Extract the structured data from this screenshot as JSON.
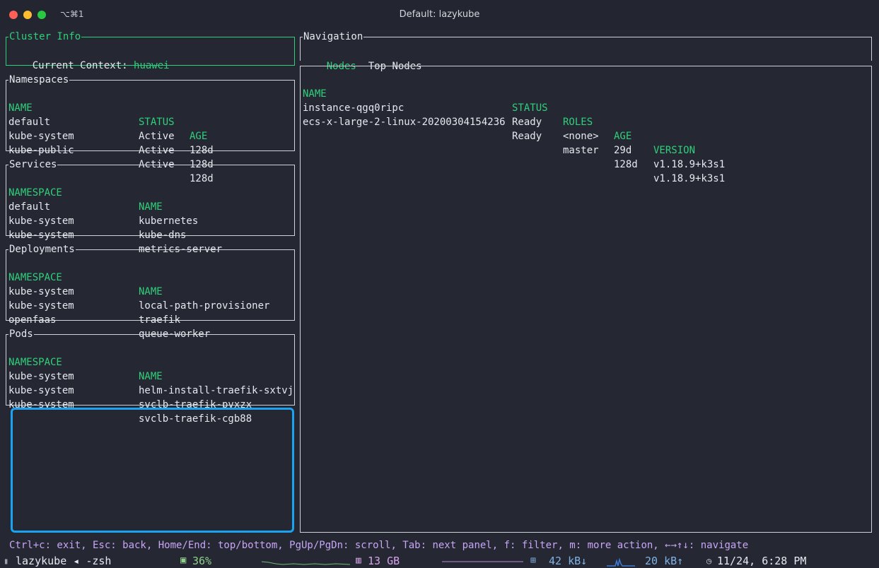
{
  "window": {
    "shortcut": "⌥⌘1",
    "title": "Default: lazykube"
  },
  "cluster_info": {
    "title": "Cluster Info",
    "context_label": "Current Context:",
    "context_value": "huawei"
  },
  "namespaces": {
    "title": "Namespaces",
    "headers": [
      "NAME",
      "STATUS",
      "AGE"
    ],
    "rows": [
      [
        "default",
        "Active",
        "128d"
      ],
      [
        "kube-system",
        "Active",
        "128d"
      ],
      [
        "kube-public",
        "Active",
        "128d"
      ]
    ]
  },
  "services": {
    "title": "Services",
    "headers": [
      "NAMESPACE",
      "NAME"
    ],
    "rows": [
      [
        "default",
        "kubernetes"
      ],
      [
        "kube-system",
        "kube-dns"
      ],
      [
        "kube-system",
        "metrics-server"
      ]
    ]
  },
  "deployments": {
    "title": "Deployments",
    "headers": [
      "NAMESPACE",
      "NAME"
    ],
    "rows": [
      [
        "kube-system",
        "local-path-provisioner"
      ],
      [
        "kube-system",
        "traefik"
      ],
      [
        "openfaas",
        "queue-worker"
      ]
    ]
  },
  "pods": {
    "title": "Pods",
    "headers": [
      "NAMESPACE",
      "NAME"
    ],
    "rows": [
      [
        "kube-system",
        "helm-install-traefik-sxtvj"
      ],
      [
        "kube-system",
        "svclb-traefik-pvxzx"
      ],
      [
        "kube-system",
        "svclb-traefik-cgb88"
      ]
    ]
  },
  "navigation": {
    "title": "Navigation",
    "tabs": [
      {
        "label": "Nodes",
        "selected": true
      },
      {
        "label": "Top Nodes",
        "selected": false
      }
    ]
  },
  "nodes": {
    "headers": [
      "NAME",
      "STATUS",
      "ROLES",
      "AGE",
      "VERSION"
    ],
    "rows": [
      [
        "instance-qgq0ripc",
        "Ready",
        "<none>",
        "29d",
        "v1.18.9+k3s1"
      ],
      [
        "ecs-x-large-2-linux-20200304154236",
        "Ready",
        "master",
        "128d",
        "v1.18.9+k3s1"
      ]
    ]
  },
  "help": "Ctrl+c: exit, Esc: back, Home/End: top/bottom, PgUp/PgDn: scroll, Tab: next panel, f: filter, m: more action, ←→↑↓: navigate",
  "status": {
    "session": "lazykube ◂ -zsh",
    "cpu": "36%",
    "mem": "13 GB",
    "net_down": "42 kB↓",
    "net_up": "20 kB↑",
    "datetime": "11/24, 6:28 PM"
  },
  "colors": {
    "accent": "#2fd07a",
    "focus_border": "#1aa3f0",
    "help_text": "#c7a6f5",
    "background": "#252833"
  }
}
